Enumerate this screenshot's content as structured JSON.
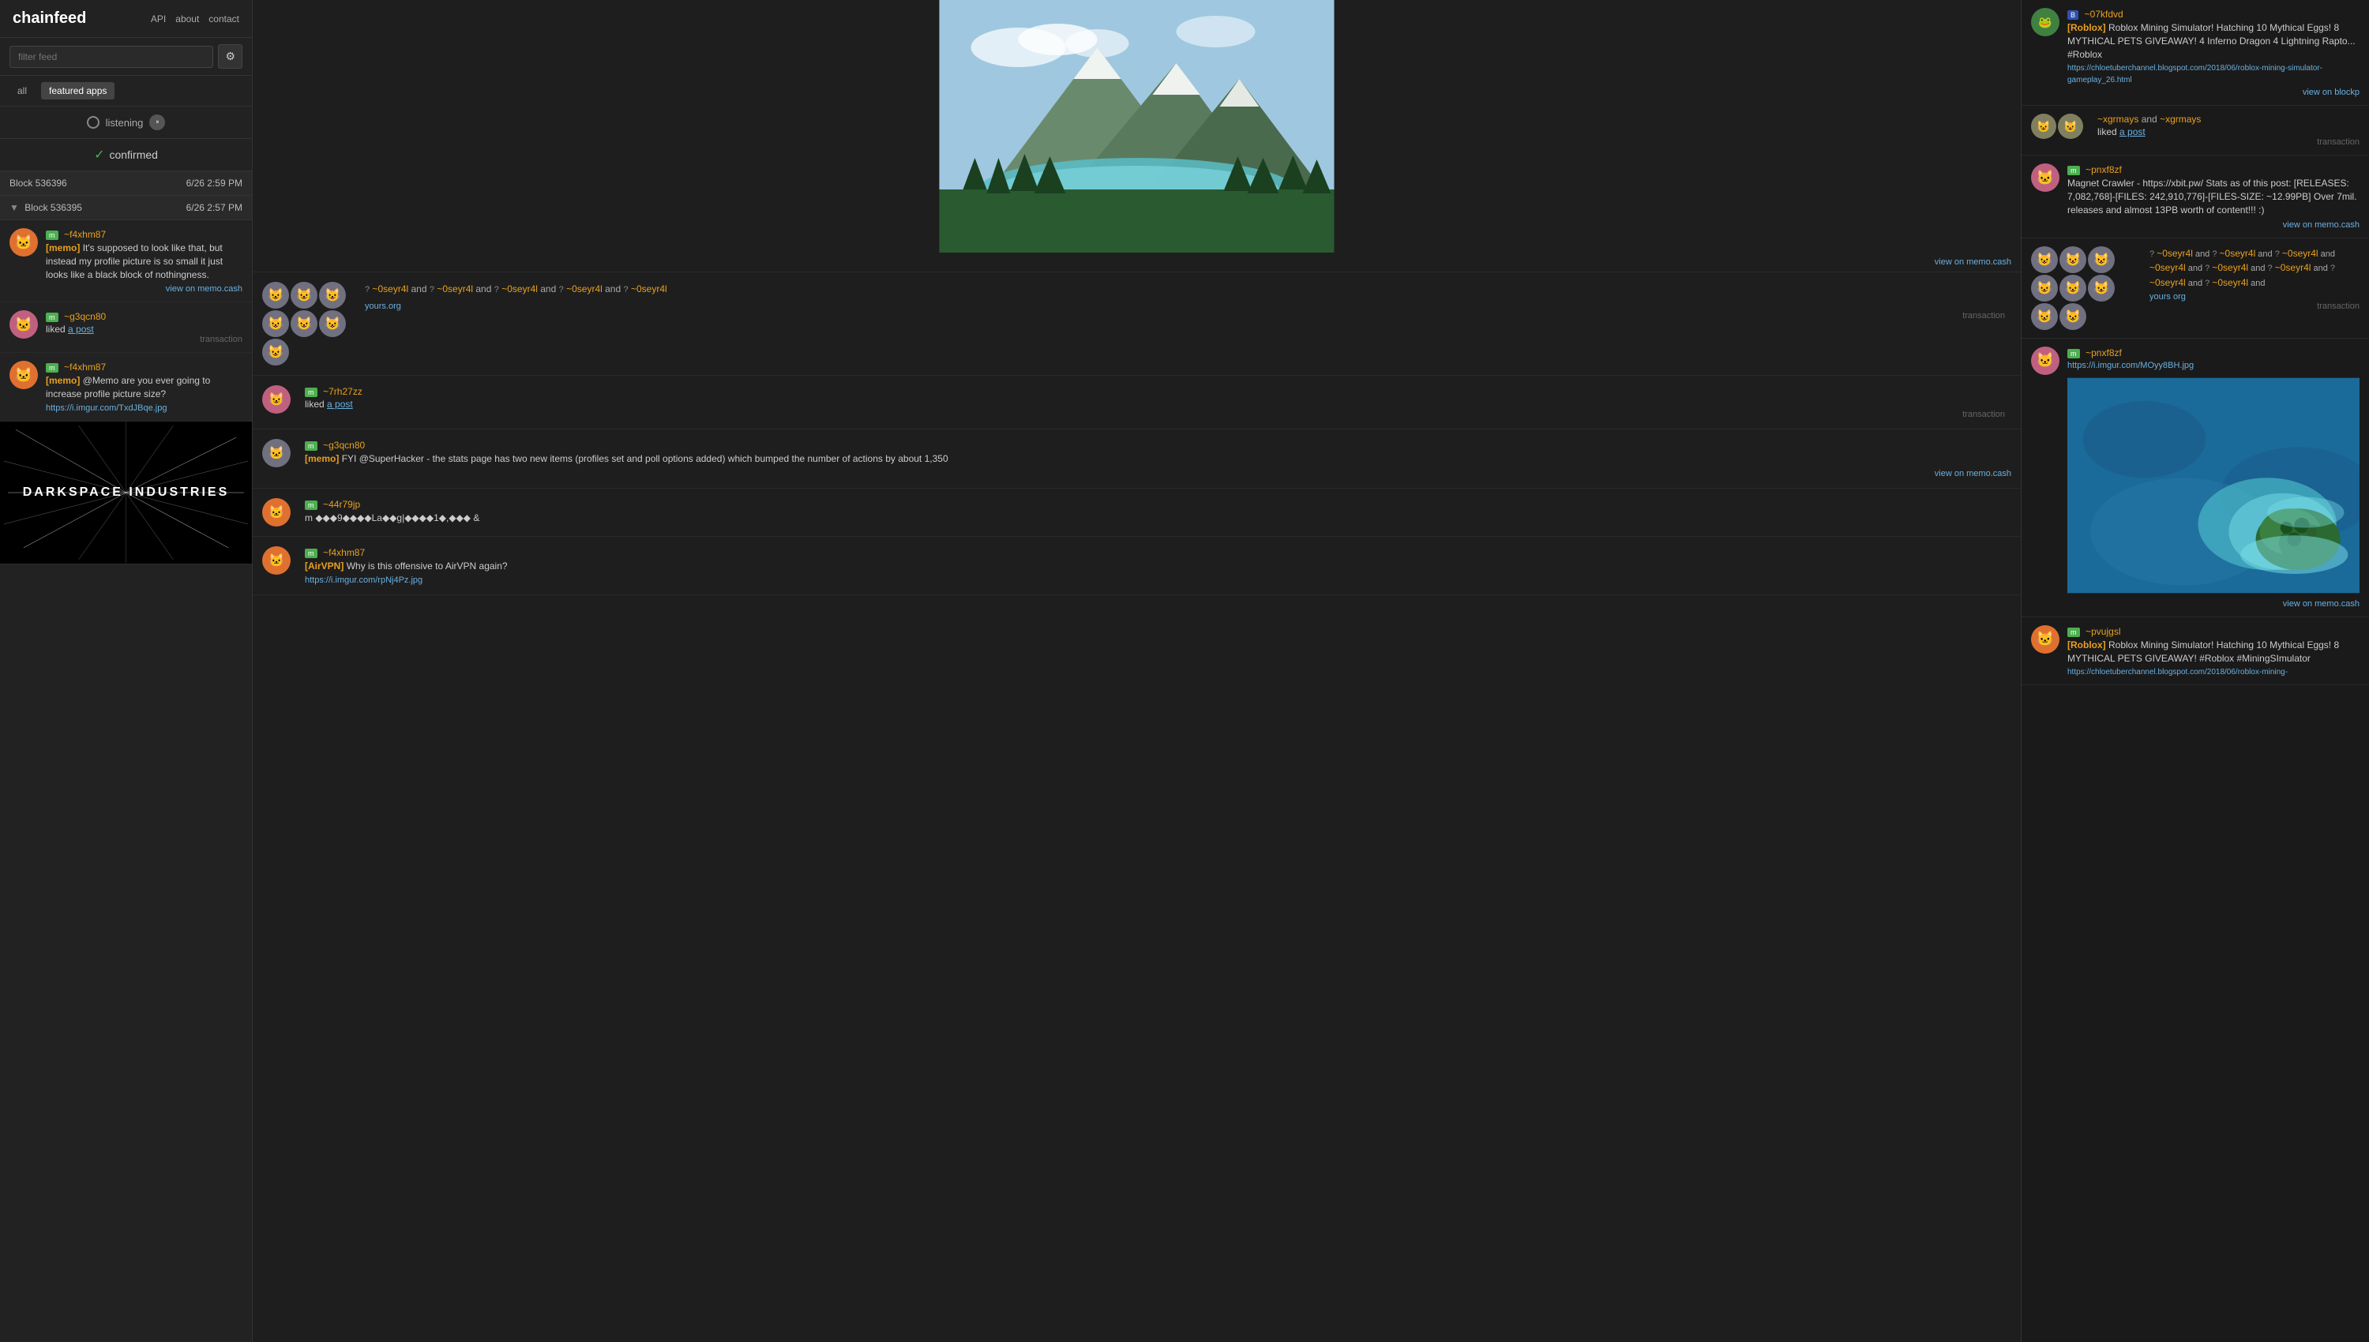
{
  "app": {
    "logo": "chainfeed",
    "nav": {
      "api": "API",
      "about": "about",
      "contact": "contact"
    }
  },
  "sidebar": {
    "filter_placeholder": "filter feed",
    "tabs": {
      "all": "all",
      "featured_apps": "featured apps"
    },
    "listening_label": "listening",
    "confirmed_label": "confirmed",
    "blocks": [
      {
        "id": "block-536396",
        "label": "Block  536396",
        "time": "6/26  2:59 PM"
      },
      {
        "id": "block-536395",
        "label": "Block  536395",
        "time": "6/26  2:57 PM"
      }
    ],
    "feed_items": [
      {
        "user": "~f4xhm87",
        "badge": "m",
        "tag": "[memo]",
        "text": " It's supposed to look like that, but instead my profile picture is so small it just looks like a black block of nothingness.",
        "link": "view on memo.cash",
        "avatar": "🐱",
        "av_class": "av-orange"
      },
      {
        "user": "~g3qcn80",
        "badge": "m",
        "liked_text": "liked",
        "post_label": "a post",
        "type": "transaction",
        "avatar": "🐱",
        "av_class": "av-pink"
      },
      {
        "user": "~f4xhm87",
        "badge": "m",
        "tag": "[memo]",
        "text": " @Memo are you ever going to increase profile picture size?",
        "link": "https://i.imgur.com/TxdJBqe.jpg",
        "avatar": "🐱",
        "av_class": "av-orange"
      }
    ],
    "darkspace_text": "DARKSPACE\nINDUSTRIES"
  },
  "middle": {
    "view_on_memo": "view on memo.cash",
    "transaction_label": "transaction",
    "items": [
      {
        "type": "avatars",
        "users_text": "~0seyr4l and ~0seyr4l and ~0seyr4l and ~0seyr4l and ~0seyr4l",
        "org": "yours.org",
        "avatar_count": 7
      },
      {
        "user": "~7rh27zz",
        "badge": "m",
        "liked_text": "liked",
        "post_label": "a post",
        "type": "transaction",
        "avatar": "😺",
        "av_class": "av-pink"
      },
      {
        "user": "~g3qcn80",
        "badge": "m",
        "tag": "[memo]",
        "text": " FYI @SuperHacker - the stats page has two new items (profiles set and poll options added) which bumped the number of actions by about 1,350",
        "link": "view on memo.cash",
        "avatar": "🐱",
        "av_class": "av-gray"
      },
      {
        "user": "~44r79jp",
        "badge": "m",
        "text": "m ◆◆◆9◆◆◆◆La◆◆g|◆◆◆◆1◆,◆◆◆ &",
        "avatar": "🐱",
        "av_class": "av-orange"
      },
      {
        "user": "~f4xhm87",
        "badge": "m",
        "tag": "[AirVPN]",
        "text": " Why is this offensive to AirVPN again?",
        "link": "https://i.imgur.com/rpNj4Pz.jpg",
        "avatar": "🐱",
        "av_class": "av-orange"
      }
    ]
  },
  "right": {
    "view_on_blockp": "view on blockp",
    "view_on_memo": "view on memo.cash",
    "transaction_label": "transaction",
    "items": [
      {
        "user": "~07kfdvd",
        "badge": "B",
        "badge_class": "av-blue-b",
        "tag": "[Roblox]",
        "text": " Roblox Mining Simulator! Hatching 10 Mythical Eggs! 8 MYTHICAL PETS GIVEAWAY! 4 Inferno Dragon 4 Lightning Rapto... #Roblox",
        "link": "https://chloetuberchannel.blogspot.com/2018/06/roblox-mining-simulator-gameplay_26.html",
        "type": "view_blockp",
        "avatar": "🐸",
        "av_class": "av-green"
      },
      {
        "type": "liked_group",
        "users": [
          "~xgrmays",
          "~xgrmays"
        ],
        "liked_text": "liked",
        "post_label": "a post",
        "type_label": "transaction"
      },
      {
        "user": "~pnxf8zf",
        "badge": "m",
        "text": "Magnet Crawler - https://xbit.pw/ Stats as of this post: [RELEASES: 7,082,768]-[FILES: 242,910,776]-[FILES-SIZE: ~12.99PB] Over 7mil. releases and almost 13PB worth of content!!! :)",
        "link": "view on memo.cash",
        "avatar": "🐱",
        "av_class": "av-pink"
      },
      {
        "type": "avatars_group",
        "users_text": "~0seyr4l and ~0seyr4l and ~0seyr4l and ~0seyr4l and ~0seyr4l and ~0seyr4l and ~0seyr4l and ~0seyr4l and",
        "org": "yours org",
        "type_label": "transaction"
      },
      {
        "user": "~pnxf8zf",
        "badge": "m",
        "link": "https://i.imgur.com/MOyy8BH.jpg",
        "link_type": "image_link",
        "type": "image",
        "avatar": "🐱",
        "av_class": "av-pink"
      },
      {
        "user": "~pvujgsl",
        "badge": "m",
        "tag": "[Roblox]",
        "text": " Roblox Mining Simulator! Hatching 10 Mythical Eggs! 8 MYTHICAL PETS GIVEAWAY! #Roblox #MiningSImulator",
        "link": "https://chloetuberchannel.blogspot.com/2018/06/roblox-mining-",
        "avatar": "🐱",
        "av_class": "av-orange"
      }
    ]
  },
  "icons": {
    "triangle_down": "▼",
    "check": "✓",
    "pause": "⏸",
    "circle": "○",
    "gear": "⚙",
    "question": "?"
  }
}
